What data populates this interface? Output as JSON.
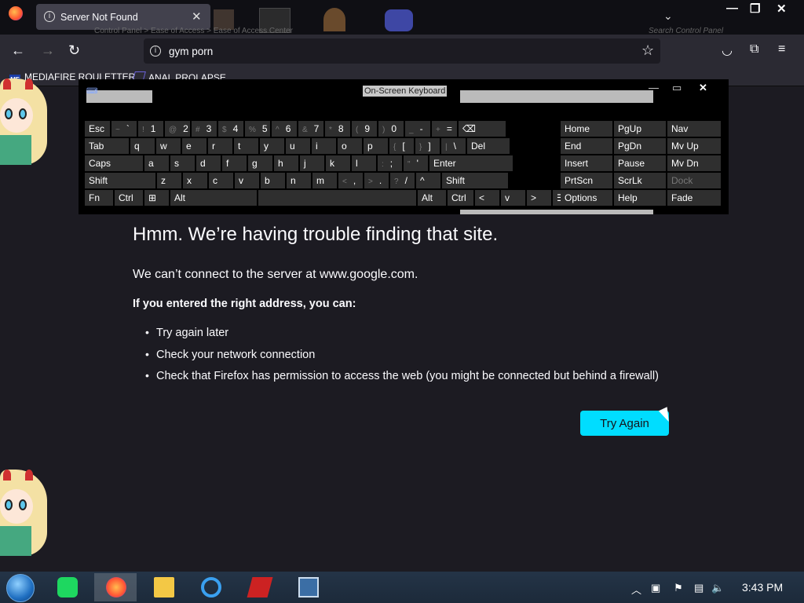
{
  "browser": {
    "tab": {
      "title": "Server Not Found"
    },
    "background_window": {
      "breadcrumb": "Control Panel  >  Ease of Access  >  Ease of Access Center",
      "search_placeholder": "Search Control Panel"
    },
    "url": "gym porn",
    "bookmarks": [
      {
        "label": "MEDIAFIRE ROULETTER",
        "icon_text": "MF"
      },
      {
        "label": "ANAL PROLAPSE"
      }
    ]
  },
  "osk": {
    "title": "On-Screen Keyboard",
    "rows": [
      [
        {
          "l": "Esc"
        },
        {
          "s": "~",
          "l": "`"
        },
        {
          "s": "!",
          "l": "1"
        },
        {
          "s": "@",
          "l": "2"
        },
        {
          "s": "#",
          "l": "3"
        },
        {
          "s": "$",
          "l": "4"
        },
        {
          "s": "%",
          "l": "5"
        },
        {
          "s": "^",
          "l": "6"
        },
        {
          "s": "&",
          "l": "7"
        },
        {
          "s": "*",
          "l": "8"
        },
        {
          "s": "(",
          "l": "9"
        },
        {
          "s": ")",
          "l": "0"
        },
        {
          "s": "_",
          "l": "-"
        },
        {
          "s": "+",
          "l": "="
        },
        {
          "l": "⌫"
        }
      ],
      [
        {
          "l": "Tab"
        },
        {
          "l": "q"
        },
        {
          "l": "w"
        },
        {
          "l": "e"
        },
        {
          "l": "r"
        },
        {
          "l": "t"
        },
        {
          "l": "y"
        },
        {
          "l": "u"
        },
        {
          "l": "i"
        },
        {
          "l": "o"
        },
        {
          "l": "p"
        },
        {
          "s": "{",
          "l": "["
        },
        {
          "s": "}",
          "l": "]"
        },
        {
          "s": "|",
          "l": "\\"
        },
        {
          "l": "Del"
        }
      ],
      [
        {
          "l": "Caps"
        },
        {
          "l": "a"
        },
        {
          "l": "s"
        },
        {
          "l": "d"
        },
        {
          "l": "f"
        },
        {
          "l": "g"
        },
        {
          "l": "h"
        },
        {
          "l": "j"
        },
        {
          "l": "k"
        },
        {
          "l": "l"
        },
        {
          "s": ":",
          "l": ";"
        },
        {
          "s": "\"",
          "l": "'"
        },
        {
          "l": "Enter"
        }
      ],
      [
        {
          "l": "Shift"
        },
        {
          "l": "z"
        },
        {
          "l": "x"
        },
        {
          "l": "c"
        },
        {
          "l": "v"
        },
        {
          "l": "b"
        },
        {
          "l": "n"
        },
        {
          "l": "m"
        },
        {
          "s": "<",
          "l": ","
        },
        {
          "s": ">",
          "l": "."
        },
        {
          "s": "?",
          "l": "/"
        },
        {
          "l": "^"
        },
        {
          "l": "Shift"
        }
      ],
      [
        {
          "l": "Fn"
        },
        {
          "l": "Ctrl"
        },
        {
          "l": "⊞"
        },
        {
          "l": "Alt"
        },
        {
          "l": ""
        },
        {
          "l": "Alt"
        },
        {
          "l": "Ctrl"
        },
        {
          "l": "<"
        },
        {
          "l": "v"
        },
        {
          "l": ">"
        },
        {
          "l": "☰"
        }
      ]
    ],
    "nav_rows": [
      [
        "Home",
        "PgUp",
        "Nav"
      ],
      [
        "End",
        "PgDn",
        "Mv Up"
      ],
      [
        "Insert",
        "Pause",
        "Mv Dn"
      ],
      [
        "PrtScn",
        "ScrLk",
        "Dock"
      ],
      [
        "Options",
        "Help",
        "Fade"
      ]
    ]
  },
  "error_page": {
    "title": "Hmm. We’re having trouble finding that site.",
    "description": "We can’t connect to the server at www.google.com.",
    "hint": "If you entered the right address, you can:",
    "suggestions": [
      "Try again later",
      "Check your network connection",
      "Check that Firefox has permission to access the web (you might be connected but behind a firewall)"
    ],
    "button": "Try Again"
  },
  "taskbar": {
    "clock": "3:43 PM"
  },
  "colors": {
    "accent": "#00ddff",
    "page_bg": "#1c1b22",
    "toolbar_bg": "#2b2a33"
  }
}
